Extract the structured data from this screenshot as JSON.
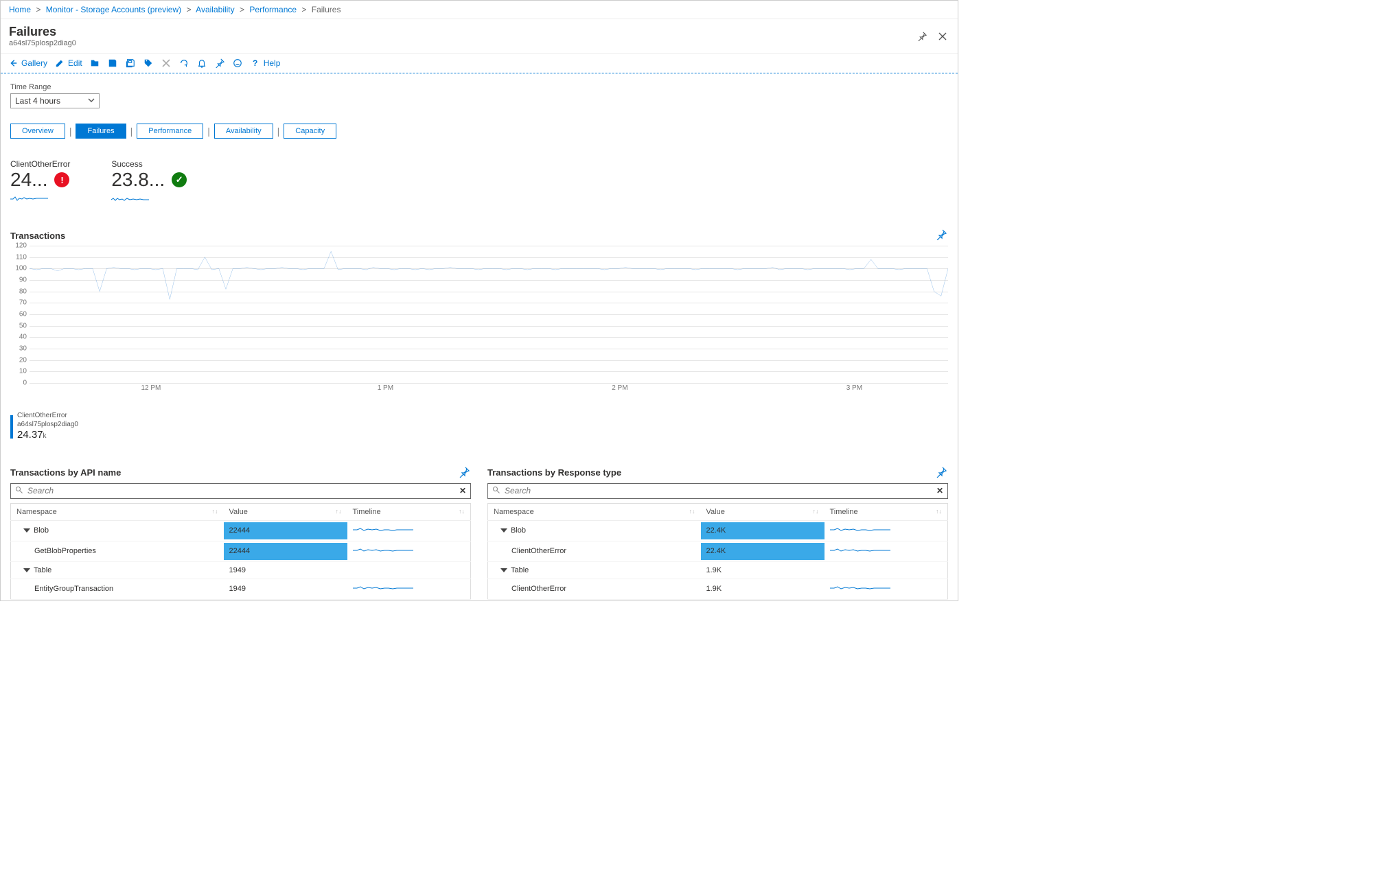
{
  "breadcrumb": {
    "items": [
      "Home",
      "Monitor - Storage Accounts (preview)",
      "Availability",
      "Performance"
    ],
    "current": "Failures"
  },
  "header": {
    "title": "Failures",
    "subtitle": "a64sl75plosp2diag0"
  },
  "toolbar": {
    "gallery": "Gallery",
    "edit": "Edit",
    "help": "Help"
  },
  "time_range": {
    "label": "Time Range",
    "value": "Last 4 hours"
  },
  "tabs": {
    "items": [
      {
        "label": "Overview"
      },
      {
        "label": "Failures"
      },
      {
        "label": "Performance"
      },
      {
        "label": "Availability"
      },
      {
        "label": "Capacity"
      }
    ],
    "active": 1
  },
  "kpis": [
    {
      "label": "ClientOtherError",
      "value": "24...",
      "status": "error"
    },
    {
      "label": "Success",
      "value": "23.8...",
      "status": "success"
    }
  ],
  "transactions_chart": {
    "title": "Transactions",
    "legend_series": "ClientOtherError",
    "legend_sub": "a64sl75plosp2diag0",
    "legend_value": "24.37",
    "legend_unit": "k"
  },
  "chart_data": {
    "type": "line",
    "title": "Transactions",
    "ylabel": "",
    "xlabel": "",
    "ylim": [
      0,
      120
    ],
    "yticks": [
      0,
      10,
      20,
      30,
      40,
      50,
      60,
      70,
      80,
      90,
      100,
      110,
      120
    ],
    "x_ticks": [
      "12 PM",
      "1 PM",
      "2 PM",
      "3 PM"
    ],
    "series": [
      {
        "name": "ClientOtherError (a64sl75plosp2diag0)",
        "values": [
          100,
          99,
          100,
          100,
          98,
          100,
          100,
          99,
          100,
          100,
          80,
          100,
          101,
          100,
          100,
          99,
          100,
          100,
          99,
          100,
          73,
          100,
          100,
          100,
          99,
          110,
          99,
          100,
          82,
          100,
          100,
          101,
          100,
          99,
          100,
          100,
          101,
          100,
          100,
          99,
          100,
          100,
          100,
          115,
          99,
          100,
          100,
          100,
          99,
          101,
          100,
          100,
          99,
          100,
          100,
          99,
          100,
          99,
          100,
          100,
          101,
          100,
          100,
          100,
          99,
          100,
          100,
          100,
          99,
          100,
          100,
          99,
          100,
          100,
          100,
          99,
          100,
          100,
          100,
          100,
          100,
          100,
          99,
          100,
          100,
          101,
          100,
          100,
          100,
          100,
          99,
          100,
          100,
          100,
          100,
          99,
          100,
          100,
          100,
          100,
          100,
          99,
          100,
          100,
          100,
          100,
          101,
          99,
          100,
          100,
          100,
          99,
          100,
          100,
          100,
          100,
          100,
          99,
          100,
          100,
          108,
          100,
          100,
          100,
          99,
          100,
          100,
          100,
          100,
          80,
          76,
          100
        ]
      }
    ]
  },
  "api_table": {
    "title": "Transactions by API name",
    "search_placeholder": "Search",
    "columns": [
      "Namespace",
      "Value",
      "Timeline"
    ],
    "rows": [
      {
        "level": 0,
        "name": "Blob",
        "value": "22444",
        "bar_pct": 100,
        "timeline": true
      },
      {
        "level": 1,
        "name": "GetBlobProperties",
        "value": "22444",
        "bar_pct": 100,
        "timeline": true
      },
      {
        "level": 0,
        "name": "Table",
        "value": "1949",
        "bar_pct": 0,
        "timeline": false
      },
      {
        "level": 1,
        "name": "EntityGroupTransaction",
        "value": "1949",
        "bar_pct": 0,
        "timeline": true
      }
    ]
  },
  "resp_table": {
    "title": "Transactions by Response type",
    "search_placeholder": "Search",
    "columns": [
      "Namespace",
      "Value",
      "Timeline"
    ],
    "rows": [
      {
        "level": 0,
        "name": "Blob",
        "value": "22.4K",
        "bar_pct": 100,
        "timeline": true
      },
      {
        "level": 1,
        "name": "ClientOtherError",
        "value": "22.4K",
        "bar_pct": 100,
        "timeline": true
      },
      {
        "level": 0,
        "name": "Table",
        "value": "1.9K",
        "bar_pct": 0,
        "timeline": false
      },
      {
        "level": 1,
        "name": "ClientOtherError",
        "value": "1.9K",
        "bar_pct": 0,
        "timeline": true
      }
    ]
  }
}
